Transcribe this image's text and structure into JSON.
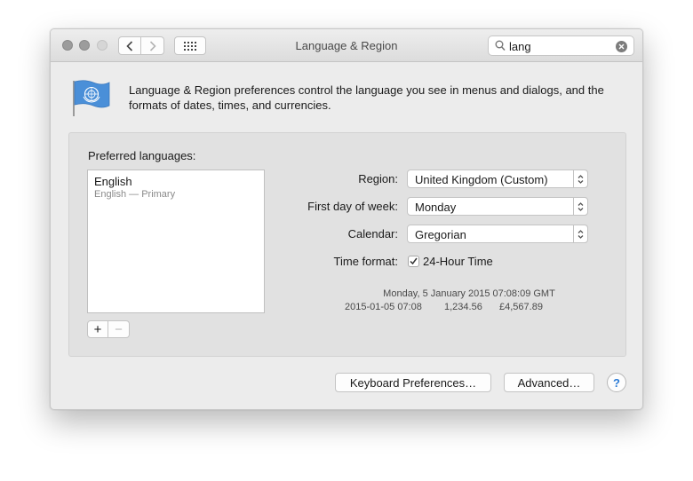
{
  "window": {
    "title": "Language & Region"
  },
  "search": {
    "value": "lang"
  },
  "description": "Language & Region preferences control the language you see in menus and dialogs, and the formats of dates, times, and currencies.",
  "languages": {
    "label": "Preferred languages:",
    "items": [
      {
        "name": "English",
        "subtitle": "English — Primary"
      }
    ]
  },
  "settings": {
    "region_label": "Region:",
    "region_value": "United Kingdom (Custom)",
    "first_day_label": "First day of week:",
    "first_day_value": "Monday",
    "calendar_label": "Calendar:",
    "calendar_value": "Gregorian",
    "time_format_label": "Time format:",
    "time_format_value": "24-Hour Time",
    "time_format_checked": true
  },
  "sample": {
    "date_long": "Monday, 5 January 2015 07:08:09 GMT",
    "date_short": "2015-01-05 07:08",
    "number": "1,234.56",
    "currency": "£4,567.89"
  },
  "buttons": {
    "keyboard": "Keyboard Preferences…",
    "advanced": "Advanced…",
    "help": "?"
  },
  "icons": {
    "flag": "un-flag-icon",
    "back": "chevron-left-icon",
    "forward": "chevron-right-icon",
    "grid": "grid-icon",
    "search": "search-icon",
    "clear": "clear-icon",
    "popup": "updown-arrows-icon",
    "check": "checkmark-icon"
  },
  "colors": {
    "flag_blue": "#4a8fd8",
    "help_blue": "#2b7bd6"
  }
}
